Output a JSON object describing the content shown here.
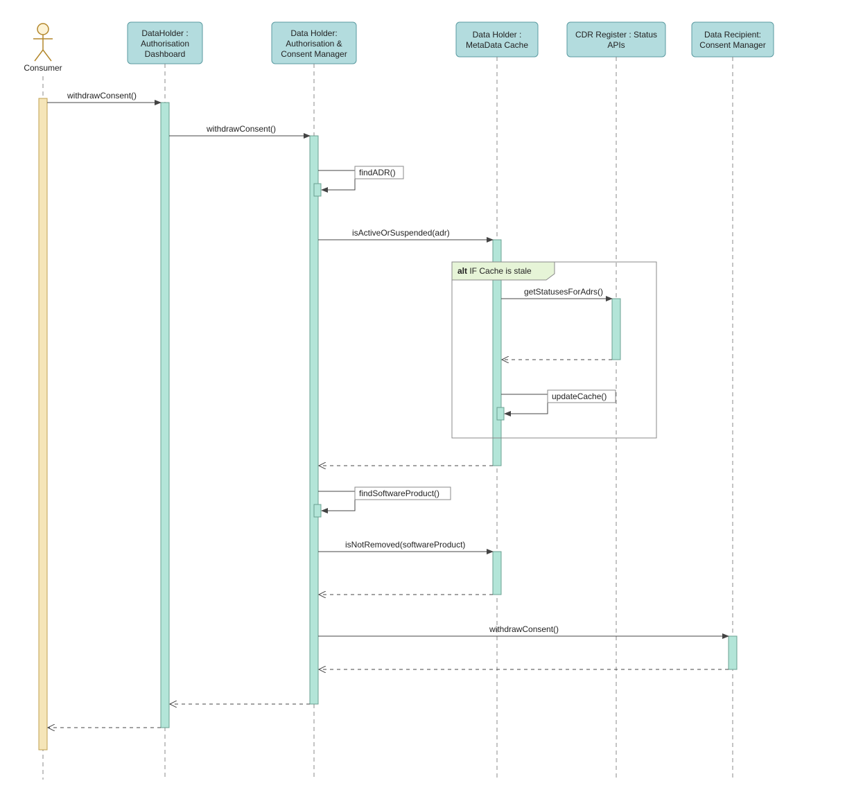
{
  "diagram_type": "sequence-diagram",
  "actor": {
    "name": "Consumer"
  },
  "participants": {
    "p1": {
      "line1": "DataHolder :",
      "line2": "Authorisation",
      "line3": "Dashboard"
    },
    "p2": {
      "line1": "Data Holder:",
      "line2": "Authorisation &",
      "line3": "Consent Manager"
    },
    "p3": {
      "line1": "Data Holder :",
      "line2": "MetaData Cache"
    },
    "p4": {
      "line1": "CDR Register : Status",
      "line2": "APIs"
    },
    "p5": {
      "line1": "Data Recipient:",
      "line2": "Consent Manager"
    }
  },
  "messages": {
    "m1": "withdrawConsent()",
    "m2": "withdrawConsent()",
    "m3": "findADR()",
    "m4": "isActiveOrSuspended(adr)",
    "m5": "getStatusesForAdrs()",
    "m6": "updateCache()",
    "m7": "findSoftwareProduct()",
    "m8": "isNotRemoved(softwareProduct)",
    "m9": "withdrawConsent()"
  },
  "fragment": {
    "label_op": "alt",
    "label_guard": " IF Cache is stale"
  }
}
